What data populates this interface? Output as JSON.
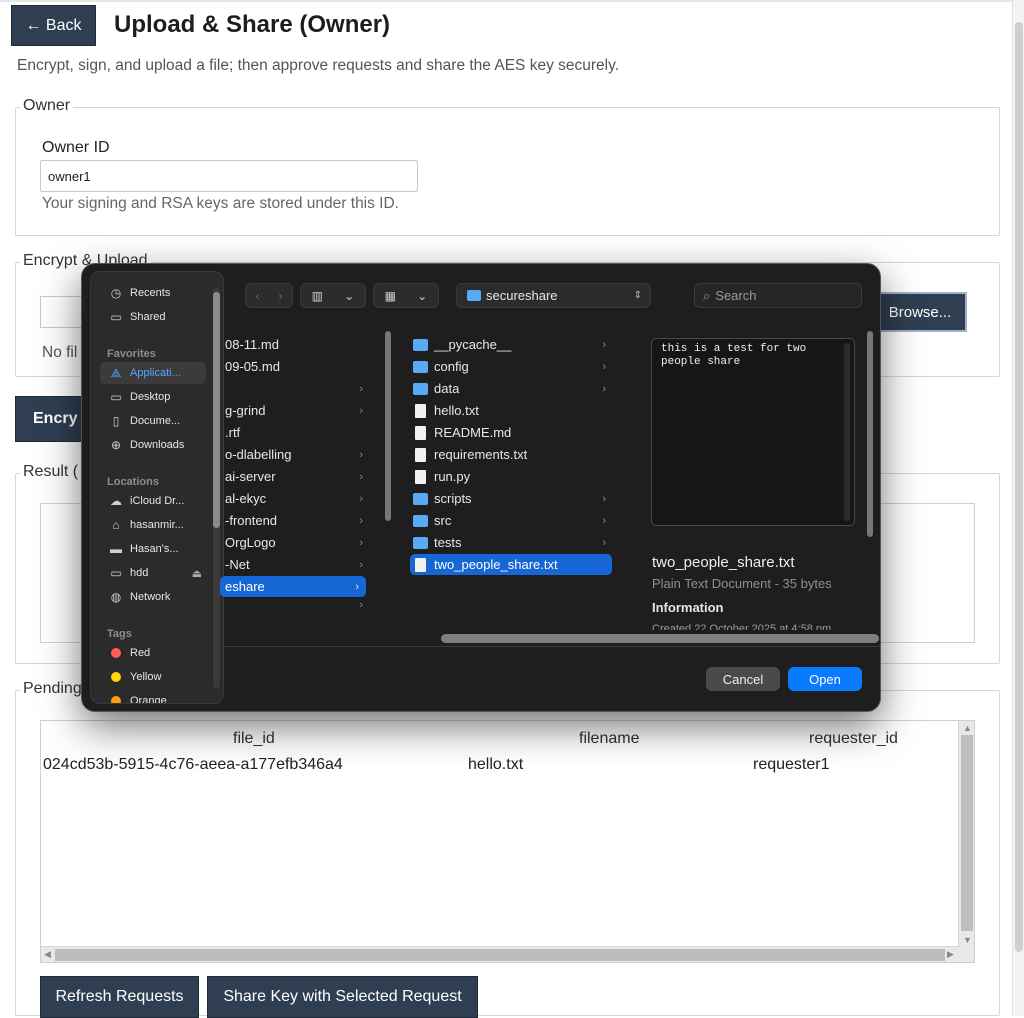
{
  "page": {
    "back_label": "← Back",
    "title": "Upload & Share (Owner)",
    "subtitle": "Encrypt, sign, and upload a file; then approve requests and share the AES key securely."
  },
  "owner": {
    "legend": "Owner",
    "label": "Owner ID",
    "value": "owner1",
    "help": "Your signing and RSA keys are stored under this ID."
  },
  "encrypt": {
    "legend": "Encrypt & Upload",
    "browse_label": "Browse...",
    "no_file_text": "No fil",
    "button_label": "Encry"
  },
  "result": {
    "legend": "Result ("
  },
  "pending": {
    "legend": "Pending",
    "columns": [
      "file_id",
      "filename",
      "requester_id"
    ],
    "rows": [
      {
        "file_id": "024cd53b-5915-4c76-aeea-a177efb346a4",
        "filename": "hello.txt",
        "requester_id": "requester1"
      }
    ],
    "refresh_label": "Refresh Requests",
    "share_label": "Share Key with Selected Request"
  },
  "dialog": {
    "sidebar": {
      "items_top": [
        {
          "label": "Recents",
          "icon": "clock-icon"
        },
        {
          "label": "Shared",
          "icon": "shared-folder-icon"
        }
      ],
      "favorites_title": "Favorites",
      "favorites": [
        {
          "label": "Applicati...",
          "icon": "applications-icon",
          "selected": true
        },
        {
          "label": "Desktop",
          "icon": "desktop-icon"
        },
        {
          "label": "Docume...",
          "icon": "document-icon"
        },
        {
          "label": "Downloads",
          "icon": "download-icon"
        }
      ],
      "locations_title": "Locations",
      "locations": [
        {
          "label": "iCloud Dr...",
          "icon": "cloud-icon"
        },
        {
          "label": "hasanmir...",
          "icon": "home-icon"
        },
        {
          "label": "Hasan's...",
          "icon": "laptop-icon"
        },
        {
          "label": "hdd",
          "icon": "drive-icon",
          "eject": "⏏"
        },
        {
          "label": "Network",
          "icon": "globe-icon"
        }
      ],
      "tags_title": "Tags",
      "tags": [
        {
          "label": "Red",
          "color": "#ff5f57"
        },
        {
          "label": "Yellow",
          "color": "#ffd60a"
        },
        {
          "label": "Orange",
          "color": "#ff9f0a"
        }
      ]
    },
    "path": "secureshare",
    "search_placeholder": "Search",
    "column1": [
      {
        "label": "08-11.md",
        "chevron": false
      },
      {
        "label": "09-05.md",
        "chevron": false
      },
      {
        "label": "",
        "chevron": true
      },
      {
        "label": "g-grind",
        "chevron": true
      },
      {
        "label": ".rtf",
        "chevron": false
      },
      {
        "label": "o-dlabelling",
        "chevron": true
      },
      {
        "label": "ai-server",
        "chevron": true
      },
      {
        "label": "al-ekyc",
        "chevron": true
      },
      {
        "label": "-frontend",
        "chevron": true
      },
      {
        "label": "OrgLogo",
        "chevron": true
      },
      {
        "label": "-Net",
        "chevron": true
      },
      {
        "label": "eshare",
        "chevron": true,
        "selected": true
      },
      {
        "label": "",
        "chevron": true
      }
    ],
    "column2": [
      {
        "label": "__pycache__",
        "type": "folder"
      },
      {
        "label": "config",
        "type": "folder"
      },
      {
        "label": "data",
        "type": "folder"
      },
      {
        "label": "hello.txt",
        "type": "file"
      },
      {
        "label": "README.md",
        "type": "file"
      },
      {
        "label": "requirements.txt",
        "type": "file"
      },
      {
        "label": "run.py",
        "type": "file"
      },
      {
        "label": "scripts",
        "type": "folder"
      },
      {
        "label": "src",
        "type": "folder"
      },
      {
        "label": "tests",
        "type": "folder"
      },
      {
        "label": "two_people_share.txt",
        "type": "file",
        "selected": true
      }
    ],
    "preview": {
      "content": "this is a test for two people share",
      "name": "two_people_share.txt",
      "kind": "Plain Text Document - 35 bytes",
      "info_title": "Information",
      "created": "Created 22 October 2025 at 4:58 pm"
    },
    "cancel_label": "Cancel",
    "open_label": "Open"
  }
}
